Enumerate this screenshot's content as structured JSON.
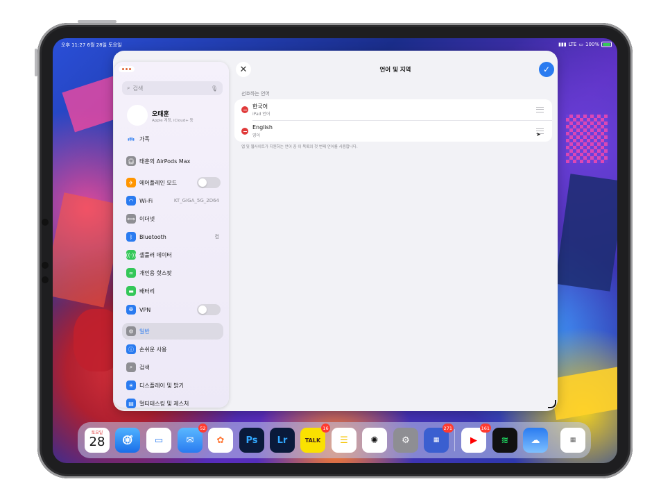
{
  "status_bar": {
    "left": "오후 11:27  6월 28일 토요일",
    "network": "LTE",
    "battery": "100%",
    "battery_level": 1.0
  },
  "sidebar": {
    "search_placeholder": "검색",
    "profile": {
      "name": "오태훈",
      "subtitle": "Apple 계정, iCloud+ 등"
    },
    "items": [
      {
        "label": "가족",
        "icon": "family-icon",
        "color": "#5ac8fa"
      },
      {
        "label": "태훈의 AirPods Max",
        "icon": "headphones-icon",
        "color": "#8e8e93"
      },
      {
        "label": "에어플레인 모드",
        "icon": "airplane-icon",
        "color": "#ff9500",
        "toggle": false
      },
      {
        "label": "Wi-Fi",
        "icon": "wifi-icon",
        "color": "#2a7bf0",
        "value": "KT_GIGA_5G_2D64"
      },
      {
        "label": "이더넷",
        "icon": "ethernet-icon",
        "color": "#8e8e93"
      },
      {
        "label": "Bluetooth",
        "icon": "bluetooth-icon",
        "color": "#2a7bf0",
        "value": "켬"
      },
      {
        "label": "셀룰러 데이터",
        "icon": "cellular-icon",
        "color": "#34c759"
      },
      {
        "label": "개인용 핫스팟",
        "icon": "hotspot-icon",
        "color": "#34c759"
      },
      {
        "label": "배터리",
        "icon": "battery-icon",
        "color": "#34c759"
      },
      {
        "label": "VPN",
        "icon": "vpn-icon",
        "color": "#2a7bf0",
        "toggle": false
      },
      {
        "label": "일반",
        "icon": "gear-icon",
        "color": "#8e8e93",
        "selected": true
      },
      {
        "label": "손쉬운 사용",
        "icon": "accessibility-icon",
        "color": "#2a7bf0"
      },
      {
        "label": "검색",
        "icon": "search-icon",
        "color": "#8e8e93"
      },
      {
        "label": "디스플레이 및 밝기",
        "icon": "brightness-icon",
        "color": "#2a7bf0"
      },
      {
        "label": "멀티태스킹 및 제스처",
        "icon": "multitasking-icon",
        "color": "#2a7bf0"
      }
    ]
  },
  "detail": {
    "title": "언어 및 지역",
    "section_header": "선호하는 언어",
    "languages": [
      {
        "name": "한국어",
        "sub": "iPad 언어"
      },
      {
        "name": "English",
        "sub": "영어"
      }
    ],
    "footer_note": "앱 및 웹사이트가 지원하는 언어 중 이 목록의 첫 번째 언어를 사용합니다."
  },
  "dock": {
    "calendar": {
      "day": "토요일",
      "date": "28"
    },
    "apps": [
      {
        "name": "calendar",
        "icon": "calendar-icon"
      },
      {
        "name": "safari",
        "icon": "compass-icon"
      },
      {
        "name": "files",
        "icon": "folder-icon"
      },
      {
        "name": "mail",
        "icon": "mail-icon",
        "badge": "52"
      },
      {
        "name": "photos",
        "icon": "photos-icon"
      },
      {
        "name": "photoshop",
        "icon": "photoshop-icon",
        "label": "Ps"
      },
      {
        "name": "lightroom",
        "icon": "lightroom-icon",
        "label": "Lr"
      },
      {
        "name": "kakaotalk",
        "icon": "kakaotalk-icon",
        "label": "TALK",
        "badge": "16"
      },
      {
        "name": "notes",
        "icon": "notes-icon"
      },
      {
        "name": "chatgpt",
        "icon": "chatgpt-icon"
      },
      {
        "name": "settings",
        "icon": "settings-icon"
      },
      {
        "name": "folder",
        "icon": "app-folder-icon",
        "badge": "271"
      },
      {
        "name": "youtube",
        "icon": "youtube-icon",
        "badge": "161"
      },
      {
        "name": "spotify",
        "icon": "spotify-icon"
      },
      {
        "name": "weather-app",
        "icon": "cloud-icon"
      },
      {
        "name": "recent",
        "icon": "spreadsheet-icon"
      }
    ]
  }
}
